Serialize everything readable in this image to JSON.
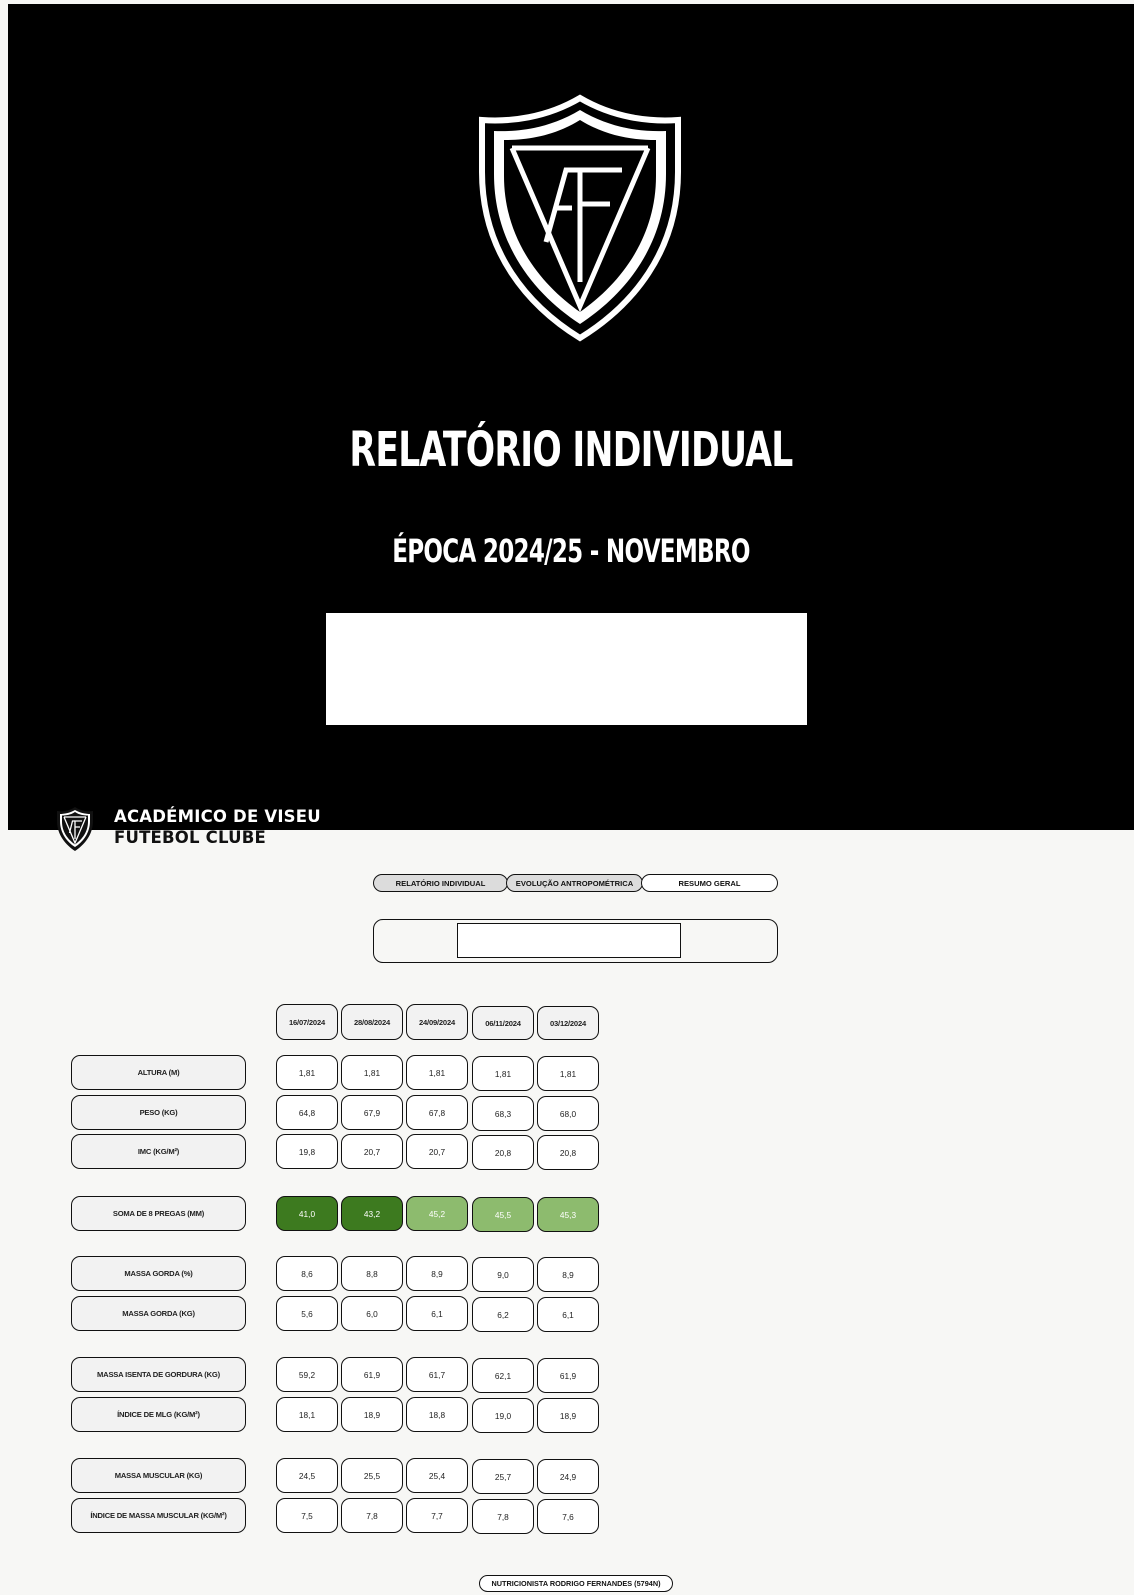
{
  "cover": {
    "title": "RELATÓRIO INDIVIDUAL",
    "subtitle": "ÉPOCA 2024/25 - NOVEMBRO",
    "logo_icon": "shield-logo-icon",
    "logo_letters": "AF"
  },
  "club": {
    "name_line1": "ACADÉMICO DE VISEU",
    "name_line2": "FUTEBOL CLUBE",
    "logo_icon": "shield-logo-icon"
  },
  "tabs": [
    {
      "label": "RELATÓRIO INDIVIDUAL",
      "style": "grey"
    },
    {
      "label": "EVOLUÇÃO ANTROPOMÉTRICA",
      "style": "grey"
    },
    {
      "label": "RESUMO GERAL",
      "style": "white"
    }
  ],
  "dates": [
    "16/07/2024",
    "28/08/2024",
    "24/09/2024",
    "06/11/2024",
    "03/12/2024"
  ],
  "groups": [
    {
      "rows": [
        {
          "label": "ALTURA (M)",
          "values": [
            "1,81",
            "1,81",
            "1,81",
            "1,81",
            "1,81"
          ]
        },
        {
          "label": "PESO (KG)",
          "values": [
            "64,8",
            "67,9",
            "67,8",
            "68,3",
            "68,0"
          ]
        },
        {
          "label": "IMC (KG/M²)",
          "values": [
            "19,8",
            "20,7",
            "20,7",
            "20,8",
            "20,8"
          ]
        }
      ]
    },
    {
      "rows": [
        {
          "label": "SOMA DE 8 PREGAS (MM)",
          "values": [
            "41,0",
            "43,2",
            "45,2",
            "45,5",
            "45,3"
          ],
          "colors": [
            "dark",
            "dark",
            "light",
            "light",
            "light"
          ]
        }
      ]
    },
    {
      "rows": [
        {
          "label": "MASSA GORDA (%)",
          "values": [
            "8,6",
            "8,8",
            "8,9",
            "9,0",
            "8,9"
          ]
        },
        {
          "label": "MASSA GORDA (KG)",
          "values": [
            "5,6",
            "6,0",
            "6,1",
            "6,2",
            "6,1"
          ]
        }
      ]
    },
    {
      "rows": [
        {
          "label": "MASSA ISENTA DE GORDURA (KG)",
          "values": [
            "59,2",
            "61,9",
            "61,7",
            "62,1",
            "61,9"
          ]
        },
        {
          "label": "ÍNDICE DE MLG (KG/M²)",
          "values": [
            "18,1",
            "18,9",
            "18,8",
            "19,0",
            "18,9"
          ]
        }
      ]
    },
    {
      "rows": [
        {
          "label": "MASSA MUSCULAR (KG)",
          "values": [
            "24,5",
            "25,5",
            "25,4",
            "25,7",
            "24,9"
          ]
        },
        {
          "label": "ÍNDICE DE MASSA MUSCULAR (KG/M²)",
          "values": [
            "7,5",
            "7,8",
            "7,7",
            "7,8",
            "7,6"
          ]
        }
      ]
    }
  ],
  "footer": {
    "nutritionist": "NUTRICIONISTA RODRIGO FERNANDES (5794N)"
  },
  "colors": {
    "dark_green": "#3d7a1f",
    "light_green": "#8dbb6e",
    "cover_bg": "#000000"
  }
}
